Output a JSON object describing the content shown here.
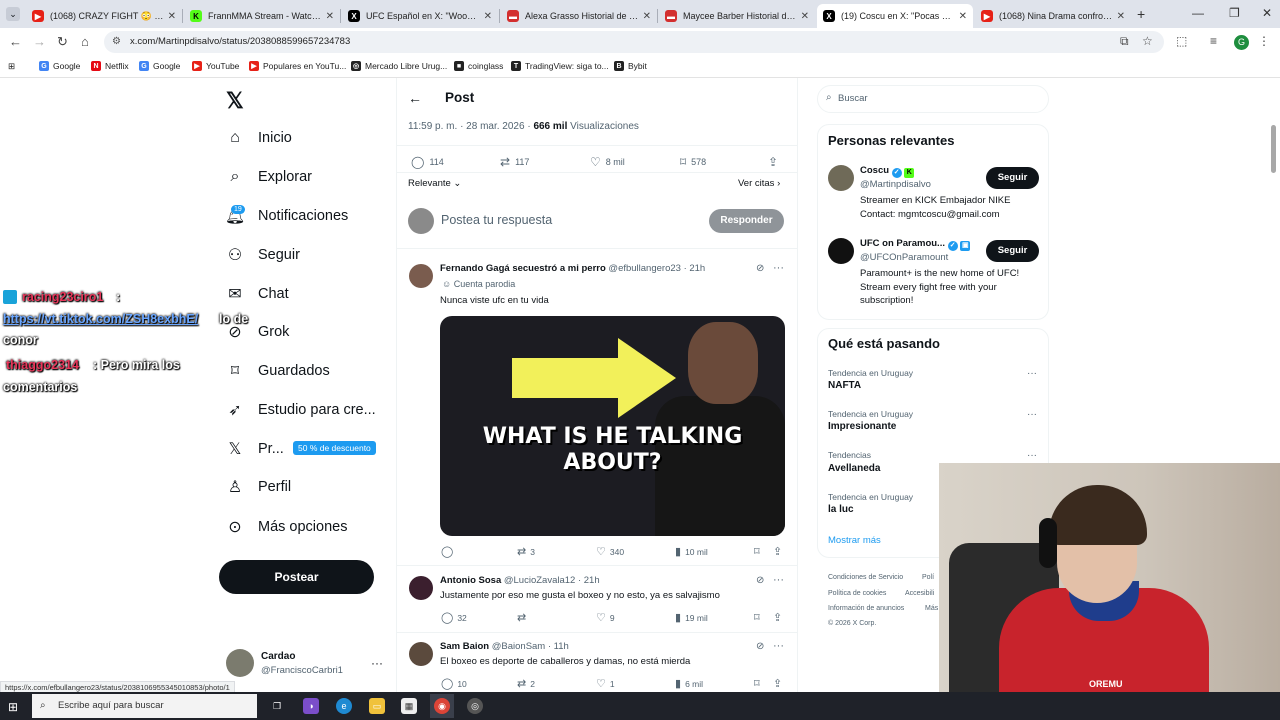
{
  "browser": {
    "tabs": [
      {
        "title": "(1068) CRAZY FIGHT 😳 | Ignac",
        "color": "#e62117",
        "icon": "youtube-icon"
      },
      {
        "title": "FrannMMA Stream - Watch Liv",
        "color": "#53fc18",
        "icon": "kick-icon"
      },
      {
        "title": "UFC Español en X: \"Woooow",
        "color": "#000000",
        "icon": "x-icon"
      },
      {
        "title": "Alexa Grasso Historial de Pele",
        "color": "#d32f2f",
        "icon": "tapology-icon"
      },
      {
        "title": "Maycee Barber Historial de Pel",
        "color": "#d32f2f",
        "icon": "tapology-icon"
      },
      {
        "title": "(19) Coscu en X: \"Pocas veces",
        "color": "#000000",
        "icon": "x-icon",
        "active": true
      },
      {
        "title": "(1068) Nina Drama confronted",
        "color": "#e62117",
        "icon": "youtube-icon"
      }
    ],
    "url": "x.com/Martinpdisalvo/status/2038088599657234783",
    "bookmarks": [
      {
        "label": "Google",
        "color": "#4285f4",
        "icon": "google-icon"
      },
      {
        "label": "Netflix",
        "color": "#e50914",
        "icon": "netflix-icon"
      },
      {
        "label": "Google",
        "color": "#4285f4",
        "icon": "google-icon"
      },
      {
        "label": "YouTube",
        "color": "#e62117",
        "icon": "youtube-icon"
      },
      {
        "label": "Populares en YouTu...",
        "color": "#e62117",
        "icon": "youtube-icon"
      },
      {
        "label": "Mercado Libre Urug...",
        "color": "#222222",
        "icon": "mercadolibre-icon"
      },
      {
        "label": "coinglass",
        "color": "#222222",
        "icon": "coinglass-icon"
      },
      {
        "label": "TradingView: siga to...",
        "color": "#222222",
        "icon": "tradingview-icon"
      },
      {
        "label": "Bybit",
        "color": "#222222",
        "icon": "bybit-icon"
      }
    ],
    "profile_initial": "G",
    "status_url": "https://x.com/efbullangero23/status/2038106955345010853/photo/1"
  },
  "nav": {
    "items": [
      {
        "label": "Inicio",
        "icon": "home-icon"
      },
      {
        "label": "Explorar",
        "icon": "search-icon"
      },
      {
        "label": "Notificaciones",
        "icon": "bell-icon"
      },
      {
        "label": "Seguir",
        "icon": "follow-icon"
      },
      {
        "label": "Chat",
        "icon": "mail-icon"
      },
      {
        "label": "Grok",
        "icon": "grok-icon"
      },
      {
        "label": "Guardados",
        "icon": "bookmark-icon"
      },
      {
        "label": "Estudio para cre...",
        "icon": "rocket-icon"
      },
      {
        "label": "Pr...",
        "icon": "x-icon"
      },
      {
        "label": "Perfil",
        "icon": "person-icon"
      },
      {
        "label": "Más opciones",
        "icon": "more-icon"
      }
    ],
    "notif_badge": "19",
    "discount": "50 % de descuento",
    "post_button": "Postear",
    "account": {
      "name": "Cardao",
      "handle": "@FranciscoCarbri1"
    }
  },
  "chat": {
    "line1_user": "racing23ciro1",
    "line1_colon": ":",
    "line2_link": "https://vt.tiktok.com/ZSH8exbhE/",
    "line2_rest": "lo de",
    "line3": "conor",
    "line4_user": "thiaggo2314",
    "line4_text": ": Pero mira los",
    "line5": "comentarios"
  },
  "post": {
    "title": "Post",
    "timestamp": "11:59 p. m. · 28 mar. 2026 ·",
    "views_count": "666 mil",
    "views_label": "Visualizaciones",
    "stats": {
      "replies": "114",
      "reposts": "117",
      "likes": "8 mil",
      "bookmarks": "578"
    },
    "sort": "Relevante",
    "quotes": "Ver citas",
    "reply_placeholder": "Postea tu respuesta",
    "reply_button": "Responder"
  },
  "replies": [
    {
      "name": "Fernando Gagá secuestró a mi perro",
      "handle": "@efbullangero23 · 21h",
      "tag": "Cuenta parodia",
      "text": "Nunca viste ufc en tu vida",
      "media_text": "WHAT IS HE TALKING ABOUT?",
      "reply": "",
      "repost": "3",
      "like": "340",
      "views": "10 mil"
    },
    {
      "name": "Antonio Sosa",
      "handle": "@LucioZavala12 · 21h",
      "text": "Justamente por eso me gusta el boxeo y no esto, ya es salvajismo",
      "reply": "32",
      "repost": "",
      "like": "9",
      "views": "19 mil"
    },
    {
      "name": "Sam Baion",
      "handle": "@BaionSam · 11h",
      "text": "El boxeo es deporte de caballeros y damas, no está mierda",
      "reply": "10",
      "repost": "2",
      "like": "1",
      "views": "6 mil"
    }
  ],
  "sidebar": {
    "search_placeholder": "Buscar",
    "relevant_title": "Personas relevantes",
    "people": [
      {
        "name": "Coscu",
        "handle": "@Martinpdisalvo",
        "bio": "Streamer en KICK Embajador NIKE Contact: mgmtcoscu@gmail.com",
        "button": "Seguir"
      },
      {
        "name": "UFC on Paramou...",
        "handle": "@UFCOnParamount",
        "bio": "Paramount+ is the new home of UFC! Stream every fight free with your subscription!",
        "button": "Seguir"
      }
    ],
    "trends_title": "Qué está pasando",
    "trends": [
      {
        "context": "Tendencia en Uruguay",
        "name": "NAFTA"
      },
      {
        "context": "Tendencia en Uruguay",
        "name": "Impresionante"
      },
      {
        "context": "Tendencias",
        "name": "Avellaneda"
      },
      {
        "context": "Tendencia en Uruguay",
        "name": "la luc"
      }
    ],
    "show_more": "Mostrar más",
    "footer": [
      "Condiciones de Servicio",
      "Polí",
      "Política de cookies",
      "Accesibili",
      "Información de anuncios",
      "Más",
      "© 2026 X Corp."
    ]
  },
  "webcam": {
    "shirt_text": "OREMU"
  },
  "taskbar": {
    "search_placeholder": "Escribe aquí para buscar"
  },
  "colors": {
    "accent": "#1d9bf0",
    "text": "#0f1419",
    "muted": "#536471"
  }
}
